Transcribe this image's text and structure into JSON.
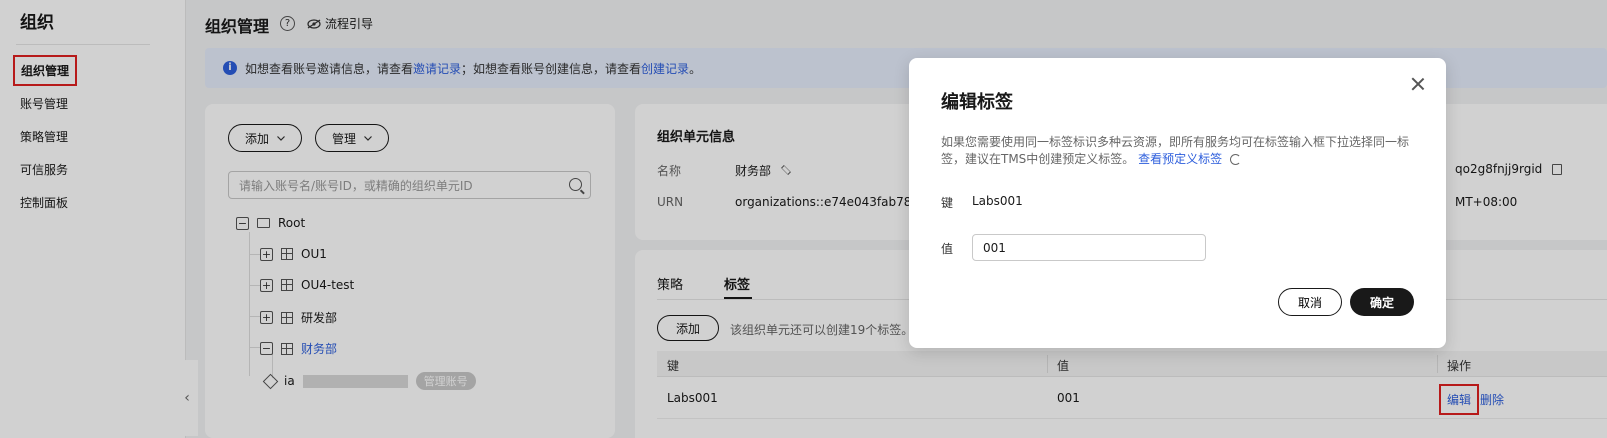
{
  "sidebar": {
    "title": "组织",
    "items": [
      {
        "label": "组织管理"
      },
      {
        "label": "账号管理"
      },
      {
        "label": "策略管理"
      },
      {
        "label": "可信服务"
      },
      {
        "label": "控制面板"
      }
    ],
    "collapse_glyph": "‹"
  },
  "header": {
    "title": "组织管理",
    "help_glyph": "?",
    "guide_label": "流程引导"
  },
  "banner": {
    "text1": "如想查看账号邀请信息，请查看",
    "link1": "邀请记录",
    "text2": "；如想查看账号创建信息，请查看",
    "link2": "创建记录",
    "text3": "。"
  },
  "tree": {
    "add_label": "添加",
    "manage_label": "管理",
    "search_placeholder": "请输入账号名/账号ID，或精确的组织单元ID",
    "root_label": "Root",
    "nodes": [
      {
        "label": "OU1",
        "toggle": "+"
      },
      {
        "label": "OU4-test",
        "toggle": "+"
      },
      {
        "label": "研发部",
        "toggle": "+"
      },
      {
        "label": "财务部",
        "toggle": "−"
      }
    ],
    "root_toggle": "−",
    "account_prefix": "ia",
    "account_badge": "管理账号"
  },
  "detail": {
    "title": "组织单元信息",
    "name_label": "名称",
    "name_value": "财务部",
    "urn_label": "URN",
    "urn_value": "organizations::e74e043fab784a4",
    "id_partial": "qo2g8fnjj9rgid",
    "time_partial": "MT+08:00"
  },
  "tags": {
    "tab_policy": "策略",
    "tab_tags": "标签",
    "add_label": "添加",
    "hint": "该组织单元还可以创建19个标签。",
    "col_key": "键",
    "col_value": "值",
    "col_action": "操作",
    "rows": [
      {
        "key": "Labs001",
        "value": "001",
        "edit": "编辑",
        "delete": "删除"
      }
    ]
  },
  "modal": {
    "title": "编辑标签",
    "desc": "如果您需要使用同一标签标识多种云资源，即所有服务均可在标签输入框下拉选择同一标签，建议在TMS中创建预定义标签。",
    "desc_link": "查看预定义标签",
    "key_label": "键",
    "key_value": "Labs001",
    "value_label": "值",
    "value_input": "001",
    "cancel_label": "取消",
    "ok_label": "确定"
  }
}
